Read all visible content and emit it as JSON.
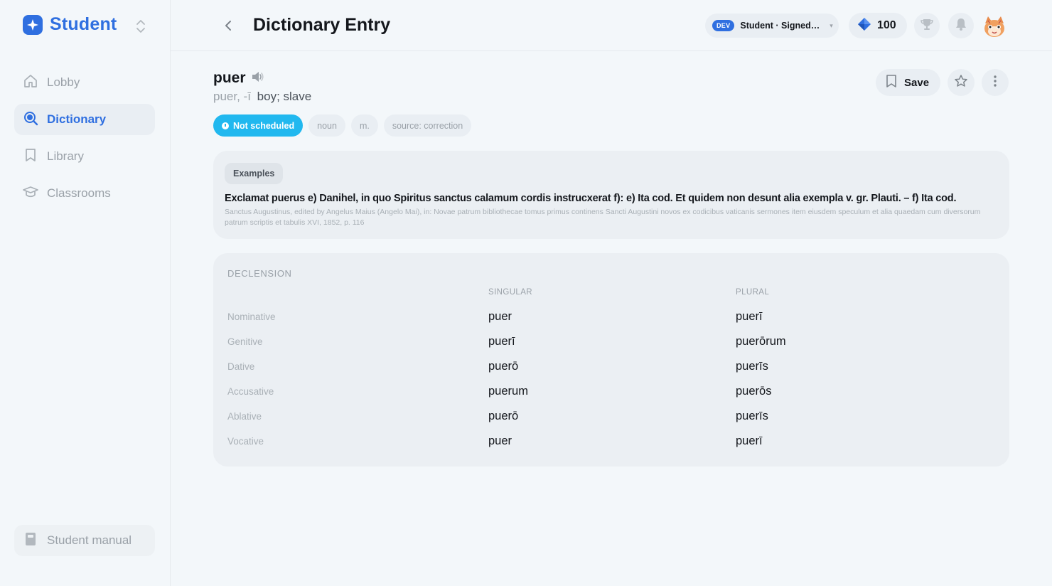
{
  "app": {
    "brand": "Student",
    "colors": {
      "accent": "#2f6fe0",
      "status": "#21b8ef",
      "background": "#f3f7fa"
    }
  },
  "sidebar": {
    "items": [
      {
        "label": "Lobby",
        "icon": "home-icon",
        "active": false
      },
      {
        "label": "Dictionary",
        "icon": "search-icon",
        "active": true
      },
      {
        "label": "Library",
        "icon": "bookmark-icon",
        "active": false
      },
      {
        "label": "Classrooms",
        "icon": "graduation-cap-icon",
        "active": false
      }
    ],
    "manual_label": "Student manual"
  },
  "header": {
    "title": "Dictionary Entry",
    "env_badge": "DEV",
    "user_label": "Student · Signed…",
    "gems": "100"
  },
  "entry": {
    "lemma": "puer",
    "forms": "puer, -ī",
    "gloss": "boy; slave",
    "tags": {
      "status": "Not scheduled",
      "pos": "noun",
      "gender": "m.",
      "source": "source: correction"
    },
    "save_label": "Save"
  },
  "examples": {
    "label": "Examples",
    "text": "Exclamat puerus e) Danihel, in quo Spiritus sanctus calamum cordis instrucxerat f): e) Ita cod. Et quidem non desunt alia exempla v. gr. Plauti. – f) Ita cod.",
    "source": "Sanctus Augustinus, edited by Angelus Maius (Angelo Mai), in: Novae patrum bibliothecae tomus primus continens Sancti Augustini novos ex codicibus vaticanis sermones item eiusdem speculum et alia quaedam cum diversorum patrum scriptis et tabulis XVI, 1852, p. 116"
  },
  "declension": {
    "title": "DECLENSION",
    "singular_header": "SINGULAR",
    "plural_header": "PLURAL",
    "rows": [
      {
        "case": "Nominative",
        "singular": "puer",
        "plural": "puerī"
      },
      {
        "case": "Genitive",
        "singular": "puerī",
        "plural": "puerōrum"
      },
      {
        "case": "Dative",
        "singular": "puerō",
        "plural": "puerīs"
      },
      {
        "case": "Accusative",
        "singular": "puerum",
        "plural": "puerōs"
      },
      {
        "case": "Ablative",
        "singular": "puerō",
        "plural": "puerīs"
      },
      {
        "case": "Vocative",
        "singular": "puer",
        "plural": "puerī"
      }
    ]
  }
}
